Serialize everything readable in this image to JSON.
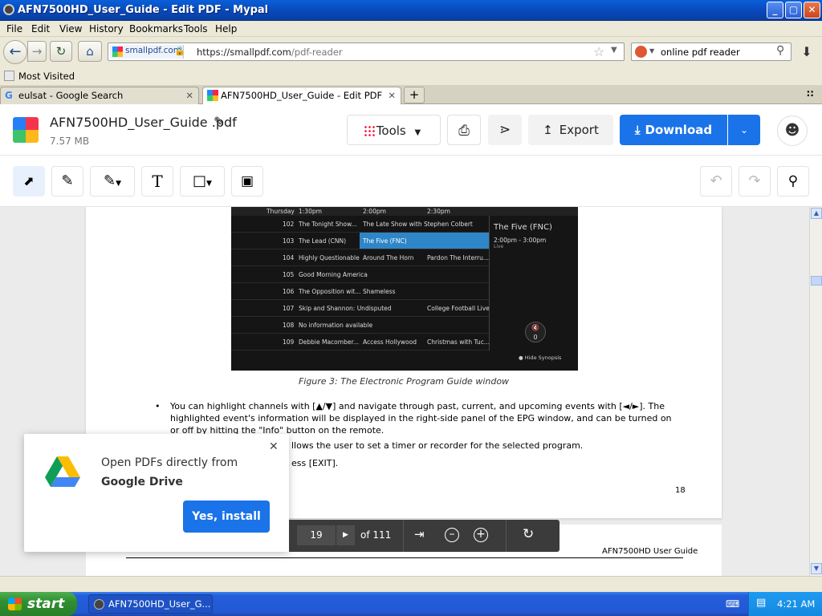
{
  "window": {
    "title": "AFN7500HD_User_Guide - Edit PDF - Mypal",
    "minimize": "_",
    "maximize": "▢",
    "close": "✕"
  },
  "menu": [
    "File",
    "Edit",
    "View",
    "History",
    "Bookmarks",
    "Tools",
    "Help"
  ],
  "nav": {
    "site_identity": "smallpdf.com",
    "url_prefix": "https://smallpdf.com",
    "url_path": "/pdf-reader",
    "search_value": "online pdf reader"
  },
  "bookmarks": {
    "most_visited": "Most Visited"
  },
  "tabs": [
    {
      "label": "eulsat - Google Search",
      "active": false
    },
    {
      "label": "AFN7500HD_User_Guide - Edit PDF",
      "active": true
    }
  ],
  "app": {
    "file_name": "AFN7500HD_User_Guide .pdf",
    "file_size": "7.57 MB",
    "tools_label": "Tools",
    "export_label": "Export",
    "download_label": "Download",
    "accent": "#1a73e8"
  },
  "epg": {
    "day": "Thursday",
    "times": [
      "1:30pm",
      "2:00pm",
      "2:30pm"
    ],
    "rows": [
      {
        "ch": "102",
        "a": "The Tonight Show...",
        "b": "The Late Show with Stephen Colbert",
        "c": ""
      },
      {
        "ch": "103",
        "a": "The Lead (CNN)",
        "b": "The Five (FNC)",
        "c": ""
      },
      {
        "ch": "104",
        "a": "Highly Questionable",
        "b": "Around The Horn",
        "c": "Pardon The Interru..."
      },
      {
        "ch": "105",
        "a": "Good Morning America",
        "b": "",
        "c": ""
      },
      {
        "ch": "106",
        "a": "The Opposition wit...",
        "b": "Shameless",
        "c": ""
      },
      {
        "ch": "107",
        "a": "Skip and Shannon: Undisputed",
        "b": "",
        "c": "College Football Live"
      },
      {
        "ch": "108",
        "a": "No information available",
        "b": "",
        "c": ""
      },
      {
        "ch": "109",
        "a": "Debbie Macomber...",
        "b": "Access Hollywood",
        "c": "Christmas with Tuc..."
      }
    ],
    "panel_title": "The Five (FNC)",
    "panel_time": "2:00pm - 3:00pm",
    "panel_status": "Live",
    "mute_count": "0",
    "hide_synopsis": "Hide Synopsis"
  },
  "doc": {
    "caption": "Figure 3: The Electronic Program Guide window",
    "bullet1": "You can highlight channels with [▲/▼] and navigate through past, current, and upcoming events with [◄/►]. The highlighted event's information will be displayed in the right-side panel of the EPG window, and can be turned on or off by hitting the \"Info\" button on the remote.",
    "bullet2_tail": "llows the user to set a timer or recorder for the selected program.",
    "bullet3_tail": "ess [EXIT].",
    "page_number": "18",
    "next_page_header": "AFN7500HD User Guide"
  },
  "popup": {
    "line1": "Open PDFs directly from",
    "line2": "Google Drive",
    "button": "Yes, install"
  },
  "pager": {
    "current_page": "19",
    "total": "of 111"
  },
  "taskbar": {
    "start": "start",
    "task": "AFN7500HD_User_G...",
    "clock": "4:21 AM"
  }
}
